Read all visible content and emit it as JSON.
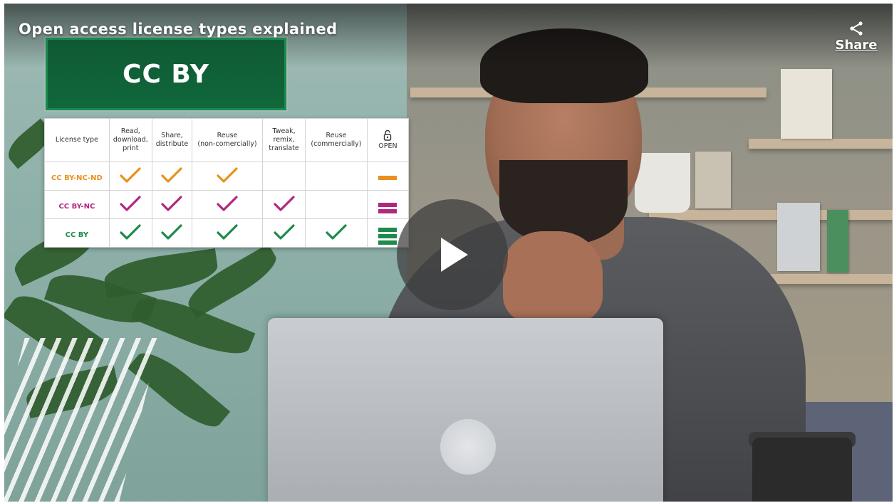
{
  "video": {
    "title": "Open access license types explained",
    "share_label": "Share"
  },
  "banner": {
    "text": "CC BY"
  },
  "license_table": {
    "headers": {
      "type": "License type",
      "read": [
        "Read,",
        "download,",
        "print"
      ],
      "share": [
        "Share,",
        "distribute"
      ],
      "reuse_nc": [
        "Reuse",
        "(non-comercially)"
      ],
      "tweak": [
        "Tweak,",
        "remix,",
        "translate"
      ],
      "reuse_c": [
        "Reuse",
        "(commercially)"
      ],
      "open": "OPEN"
    },
    "rows": [
      {
        "label": "CC BY-NC-ND",
        "color": "#e8911e",
        "permissions": [
          true,
          true,
          true,
          false,
          false
        ],
        "open_bars": 1
      },
      {
        "label": "CC BY-NC",
        "color": "#b0287e",
        "permissions": [
          true,
          true,
          true,
          true,
          false
        ],
        "open_bars": 2
      },
      {
        "label": "CC BY",
        "color": "#1f8a4c",
        "permissions": [
          true,
          true,
          true,
          true,
          true
        ],
        "open_bars": 3
      }
    ]
  },
  "colors": {
    "banner_green": "#11673b",
    "play_overlay": "#3c3c3c"
  },
  "icons": {
    "share": "share-icon",
    "play": "play-icon",
    "lock": "open-lock-icon",
    "check": "check-icon"
  }
}
